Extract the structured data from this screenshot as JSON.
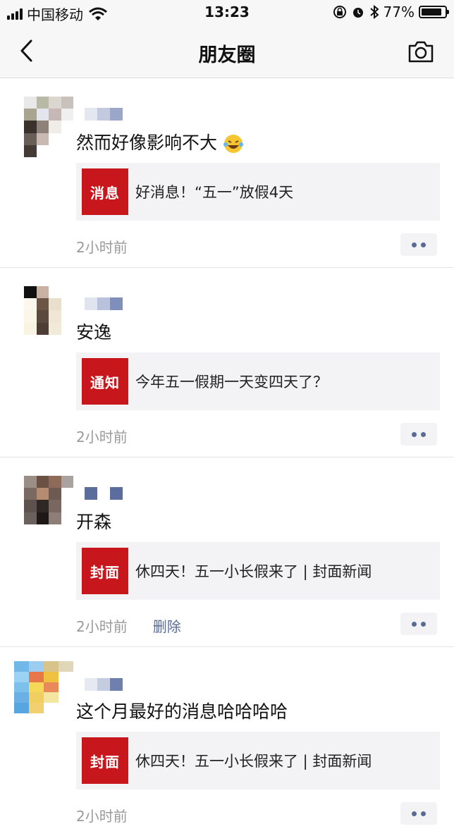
{
  "status_bar": {
    "carrier": "中国移动",
    "time": "13:23",
    "battery_percent": "77%",
    "battery_level": 0.77,
    "icons": [
      "signal-icon",
      "wifi-icon",
      "rotation-lock-icon",
      "alarm-icon",
      "bluetooth-icon",
      "battery-icon"
    ]
  },
  "nav": {
    "title": "朋友圈",
    "back_icon": "chevron-left-icon",
    "camera_icon": "camera-icon"
  },
  "colors": {
    "link_blue": "#576b95",
    "meta_gray": "#9a9a9a",
    "thumb_red": "#c8161d"
  },
  "posts": [
    {
      "text": "然而好像影响不大",
      "emoji": "laughing-tears-emoji",
      "link": {
        "thumb_text": "消息",
        "title": "好消息！“五一”放假4天"
      },
      "time": "2小时前",
      "delete": ""
    },
    {
      "text": "安逸",
      "emoji": "",
      "link": {
        "thumb_text": "通知",
        "title": "今年五一假期一天变四天了？"
      },
      "time": "2小时前",
      "delete": ""
    },
    {
      "text": "开森",
      "emoji": "",
      "link": {
        "thumb_text": "封面",
        "title": "休四天！五一小长假来了 | 封面新闻"
      },
      "time": "2小时前",
      "delete": "删除"
    },
    {
      "text": "这个月最好的消息哈哈哈哈",
      "emoji": "",
      "link": {
        "thumb_text": "封面",
        "title": "休四天！五一小长假来了 | 封面新闻"
      },
      "time": "2小时前",
      "delete": ""
    }
  ]
}
